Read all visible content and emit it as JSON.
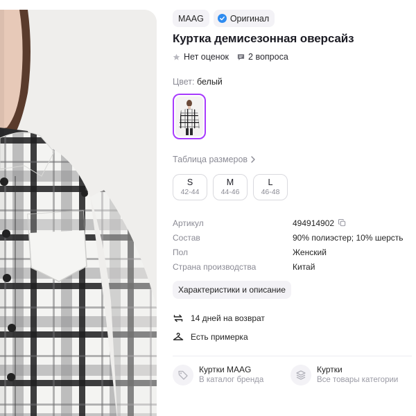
{
  "product": {
    "brand": "MAAG",
    "original_badge": "Оригинал",
    "title": "Куртка демисезонная оверсайз",
    "rating_text": "Нет оценок",
    "questions_text": "2 вопроса"
  },
  "color": {
    "label": "Цвет:",
    "value": "белый"
  },
  "sizes": {
    "table_link": "Таблица размеров",
    "options": [
      {
        "size": "S",
        "range": "42-44"
      },
      {
        "size": "M",
        "range": "44-46"
      },
      {
        "size": "L",
        "range": "46-48"
      }
    ]
  },
  "specs": [
    {
      "key": "Артикул",
      "value": "494914902"
    },
    {
      "key": "Состав",
      "value": "90% полиэстер; 10% шерсть"
    },
    {
      "key": "Пол",
      "value": "Женский"
    },
    {
      "key": "Страна производства",
      "value": "Китай"
    }
  ],
  "characteristics_button": "Характеристики и описание",
  "features": [
    {
      "icon": "return-arrows-icon",
      "text": "14 дней на возврат"
    },
    {
      "icon": "hanger-icon",
      "text": "Есть примерка"
    }
  ],
  "links": [
    {
      "icon": "tag-icon",
      "title": "Куртки MAAG",
      "subtitle": "В каталог бренда"
    },
    {
      "icon": "stack-icon",
      "title": "Куртки",
      "subtitle": "Все товары категории"
    }
  ],
  "colors": {
    "accent": "#a73afd",
    "verified": "#2f8cf0",
    "chip_bg": "#f3f2f6",
    "muted_text": "#8a8a94"
  }
}
